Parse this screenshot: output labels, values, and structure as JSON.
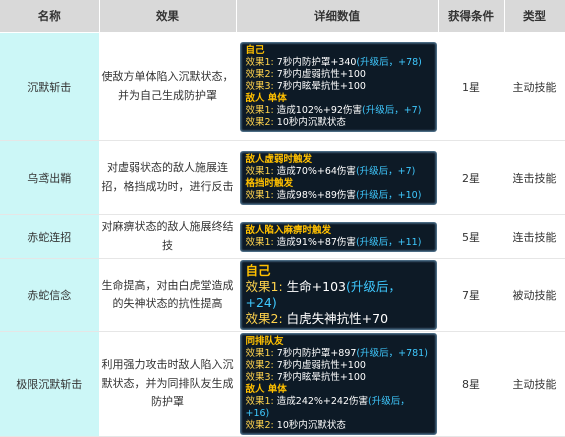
{
  "headers": [
    "名称",
    "效果",
    "详细数值",
    "获得条件",
    "类型"
  ],
  "rows": [
    {
      "name": "沉默斩击",
      "effect": "使敌方单体陷入沉默状态，并为自己生成防护罩",
      "condition": "1星",
      "type": "主动技能",
      "detail": [
        {
          "t": "自己",
          "k": "hd"
        },
        {
          "l": "效果1:",
          "v": " 7秒内防护罩+340",
          "u": "(升级后，+78)"
        },
        {
          "l": "效果2:",
          "v": " 7秒内虚弱抗性+100"
        },
        {
          "l": "效果3:",
          "v": " 7秒内眩晕抗性+100"
        },
        {
          "t": "敌人 单体",
          "k": "hd"
        },
        {
          "l": "效果1:",
          "v": " 造成102%+92伤害",
          "u": "(升级后，+7)"
        },
        {
          "l": "效果2:",
          "v": " 10秒内沉默状态"
        }
      ]
    },
    {
      "name": "乌鸢出鞘",
      "effect": "对虚弱状态的敌人施展连招，格挡成功时，进行反击",
      "condition": "2星",
      "type": "连击技能",
      "detail": [
        {
          "t": "敌人虚弱时触发",
          "k": "hd"
        },
        {
          "l": "效果1:",
          "v": " 造成70%+64伤害",
          "u": "(升级后，+7)"
        },
        {
          "t": "格挡时触发",
          "k": "hd"
        },
        {
          "l": "效果1:",
          "v": " 造成98%+89伤害",
          "u": "(升级后，+10)"
        }
      ]
    },
    {
      "name": "赤蛇连招",
      "effect": "对麻痹状态的敌人施展终结技",
      "condition": "5星",
      "type": "连击技能",
      "detail": [
        {
          "t": "敌人陷入麻痹时触发",
          "k": "hd"
        },
        {
          "l": "效果1:",
          "v": " 造成91%+87伤害",
          "u": "(升级后，+11)"
        }
      ]
    },
    {
      "name": "赤蛇信念",
      "effect": "生命提高，对由白虎堂造成的失神状态的抗性提高",
      "condition": "7星",
      "type": "被动技能",
      "big": true,
      "detail": [
        {
          "t": "自己",
          "k": "hd"
        },
        {
          "l": "效果1:",
          "v": " 生命+103",
          "u": "(升级后，+24)"
        },
        {
          "l": "效果2:",
          "v": " 白虎失神抗性+70"
        }
      ]
    },
    {
      "name": "极限沉默斩击",
      "effect": "利用强力攻击时敌人陷入沉默状态，并为同排队友生成防护罩",
      "condition": "8星",
      "type": "主动技能",
      "detail": [
        {
          "t": "同排队友",
          "k": "hd"
        },
        {
          "l": "效果1:",
          "v": " 7秒内防护罩+897",
          "u": "(升级后，+781)"
        },
        {
          "l": "效果2:",
          "v": " 7秒内虚弱抗性+100"
        },
        {
          "l": "效果3:",
          "v": " 7秒内眩晕抗性+100"
        },
        {
          "t": "敌人 单体",
          "k": "hd"
        },
        {
          "l": "效果1:",
          "v": " 造成242%+242伤害",
          "u": "(升级后，+16)"
        },
        {
          "l": "效果2:",
          "v": " 10秒内沉默状态"
        }
      ]
    }
  ]
}
